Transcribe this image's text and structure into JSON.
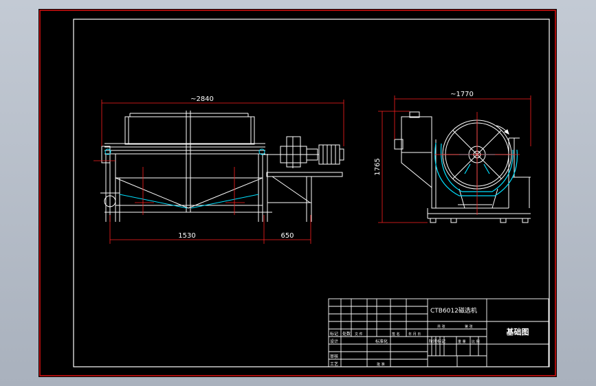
{
  "drawing": {
    "front_view": {
      "overall_length_label": "~2840",
      "left_span_label": "1530",
      "right_span_label": "650"
    },
    "side_view": {
      "overall_width_label": "~1770",
      "height_label": "1765"
    },
    "title_block": {
      "model_name": "CTB6012磁选机",
      "drawing_title": "基础图",
      "labels": {
        "mark": "标记",
        "count": "处数",
        "file": "文 件",
        "sign": "签 名",
        "date": "年 月 日",
        "design": "设计",
        "standard": "标准化",
        "review": "审核",
        "craft": "工艺",
        "approve": "批 准",
        "stage_mark": "阶段标记",
        "weight": "重 量",
        "scale": "比 例",
        "sheets": "共 张",
        "sheet": "第 张"
      }
    }
  },
  "colors": {
    "line": "#ffffff",
    "dimension": "#ff2020",
    "accent": "#00e0ff",
    "border": "#e01010"
  }
}
